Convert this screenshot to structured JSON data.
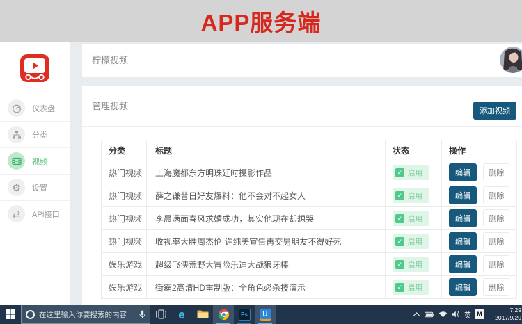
{
  "banner": {
    "title": "APP服务端"
  },
  "header": {
    "app_title": "柠檬视频"
  },
  "sidebar": {
    "items": [
      {
        "label": "仪表盘",
        "icon": "dashboard-icon",
        "active": false
      },
      {
        "label": "分类",
        "icon": "category-icon",
        "active": false
      },
      {
        "label": "视频",
        "icon": "video-icon",
        "active": true
      },
      {
        "label": "设置",
        "icon": "settings-icon",
        "active": false
      },
      {
        "label": "API接口",
        "icon": "api-icon",
        "active": false
      }
    ]
  },
  "main": {
    "card_title": "管理视频",
    "add_button_label": "添加视频",
    "table": {
      "columns": [
        "分类",
        "标题",
        "状态",
        "操作"
      ],
      "edit_label": "编辑",
      "delete_label": "删除",
      "rows": [
        {
          "category": "热门视频",
          "title": "上海魔都东方明珠延时摄影作品",
          "status": "启用"
        },
        {
          "category": "热门视频",
          "title": "薛之谦昔日好友爆料：他不会对不起女人",
          "status": "启用"
        },
        {
          "category": "热门视频",
          "title": "李晨满面春风求婚成功，其实他现在却想哭",
          "status": "启用"
        },
        {
          "category": "热门视频",
          "title": "收视率大胜周杰伦 许纯美宣告再交男朋友不得好死",
          "status": "启用"
        },
        {
          "category": "娱乐游戏",
          "title": "超级飞侠荒野大冒险乐迪大战狼牙棒",
          "status": "启用"
        },
        {
          "category": "娱乐游戏",
          "title": "街霸2高清HD重制版：全角色必杀技演示",
          "status": "启用"
        }
      ]
    }
  },
  "taskbar": {
    "search_placeholder": "在这里输入你要搜索的内容",
    "ime_indicator": "英",
    "input_method_badge": "M",
    "clock_time": "7:29",
    "clock_date": "2017/9/20"
  },
  "icons": {
    "check": "✓",
    "gear": "⚙",
    "api_arrows": "⇄",
    "edge_letter": "e",
    "ps_label": "Ps",
    "u_label": "U"
  },
  "colors": {
    "banner_text": "#d7281e",
    "banner_bg": "#d4d4d4",
    "primary_button": "#17597c",
    "active_green": "#67c388",
    "badge_bg": "#def5e7",
    "taskbar_bg": "#223449"
  }
}
